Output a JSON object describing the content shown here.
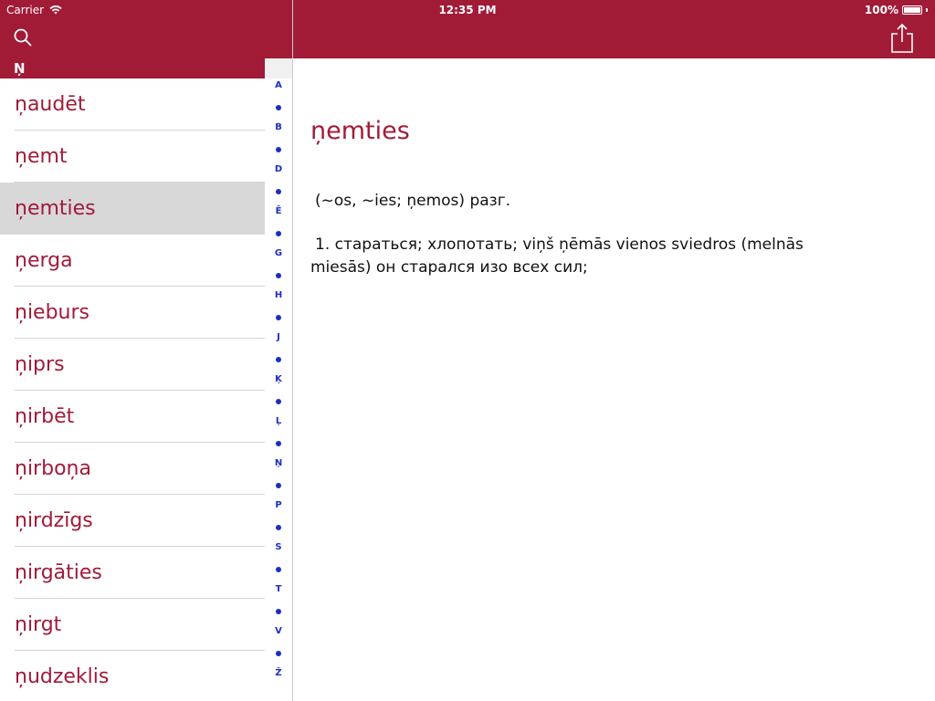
{
  "status_bar": {
    "carrier": "Carrier",
    "time": "12:35 PM",
    "battery": "100%"
  },
  "colors": {
    "brand": "#a11b37",
    "index_blue": "#1a2fc0",
    "selected_row": "#d8d8d8"
  },
  "toolbar": {
    "search_icon": "search-icon",
    "share_icon": "share-icon"
  },
  "sidebar": {
    "section_header": "Ņ",
    "selected_index": 2,
    "items": [
      {
        "label": "ņaudēt"
      },
      {
        "label": "ņemt"
      },
      {
        "label": "ņemties"
      },
      {
        "label": "ņerga"
      },
      {
        "label": "ņieburs"
      },
      {
        "label": "ņiprs"
      },
      {
        "label": "ņirbēt"
      },
      {
        "label": "ņirboņa"
      },
      {
        "label": "ņirdzīgs"
      },
      {
        "label": "ņirgāties"
      },
      {
        "label": "ņirgt"
      },
      {
        "label": "ņudzeklis"
      }
    ]
  },
  "index_letters": [
    "A",
    "B",
    "D",
    "Ē",
    "G",
    "H",
    "J",
    "Ķ",
    "Ļ",
    "Ņ",
    "P",
    "S",
    "T",
    "V",
    "Ž"
  ],
  "detail": {
    "headword": "ņemties",
    "grammar": "(~os, ~ies; ņemos) разг.",
    "definition_line1": "1. стараться; хлопотать; viņš ņēmās vienos sviedros (melnās",
    "definition_line2": "miesās) он старался изо всех сил;"
  }
}
